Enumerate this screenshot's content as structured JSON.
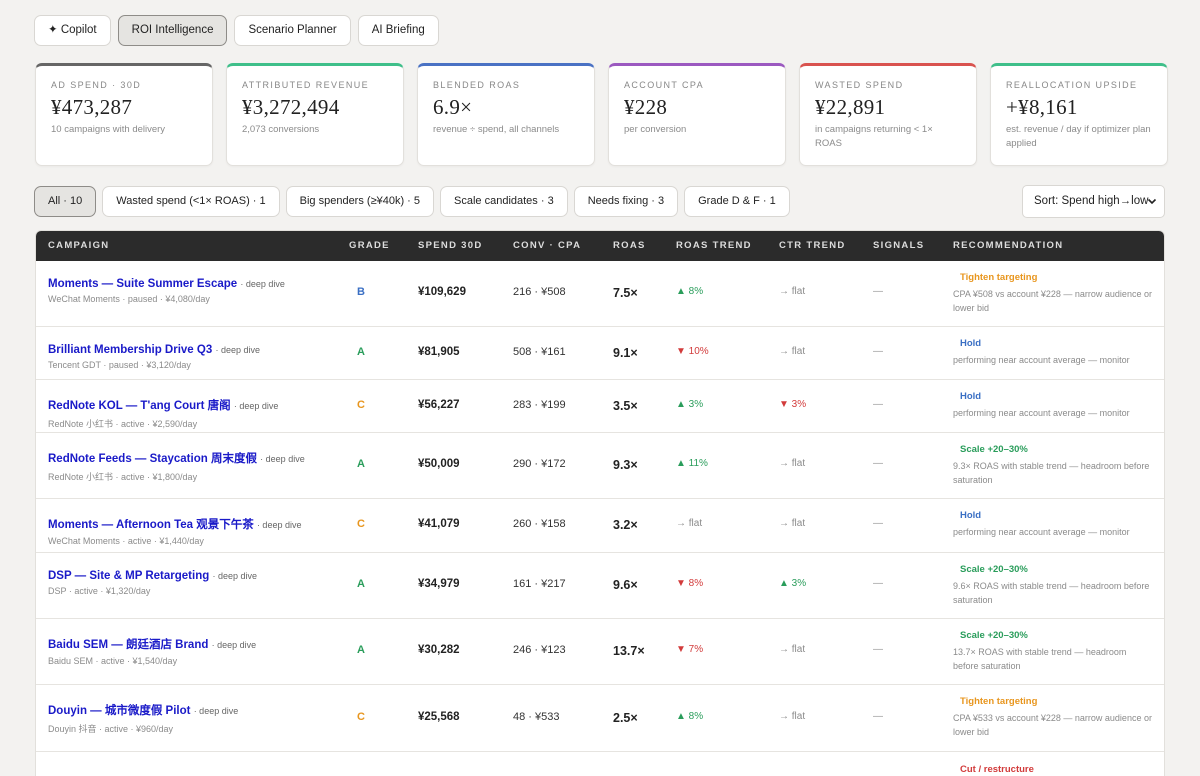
{
  "tabs": [
    {
      "label": "✦ Copilot",
      "active": false
    },
    {
      "label": "ROI Intelligence",
      "active": true
    },
    {
      "label": "Scenario Planner",
      "active": false
    },
    {
      "label": "AI Briefing",
      "active": false
    }
  ],
  "kpis": [
    {
      "label": "Ad spend · 30d",
      "value": "¥473,287",
      "sub": "10 campaigns with delivery",
      "color": "#666666"
    },
    {
      "label": "Attributed revenue",
      "value": "¥3,272,494",
      "sub": "2,073 conversions",
      "color": "#3fbf8a"
    },
    {
      "label": "Blended ROAS",
      "value": "6.9×",
      "sub": "revenue ÷ spend, all channels",
      "color": "#4a72c4"
    },
    {
      "label": "Account CPA",
      "value": "¥228",
      "sub": "per conversion",
      "color": "#9b59c0"
    },
    {
      "label": "Wasted spend",
      "value": "¥22,891",
      "sub": "in campaigns returning < 1× ROAS",
      "color": "#d9534f"
    },
    {
      "label": "Reallocation upside",
      "value": "+¥8,161",
      "sub": "est. revenue / day if optimizer plan applied",
      "color": "#3fbf8a"
    }
  ],
  "filters": [
    {
      "label": "All · 10",
      "active": true
    },
    {
      "label": "Wasted spend (<1× ROAS) · 1",
      "active": false
    },
    {
      "label": "Big spenders (≥¥40k) · 5",
      "active": false
    },
    {
      "label": "Scale candidates · 3",
      "active": false
    },
    {
      "label": "Needs fixing · 3",
      "active": false
    },
    {
      "label": "Grade D & F · 1",
      "active": false
    }
  ],
  "sort": {
    "label": "Sort: Spend high→low"
  },
  "table": {
    "headers": [
      "Campaign",
      "Grade",
      "Spend 30d",
      "Conv · CPA",
      "ROAS",
      "ROAS trend",
      "CTR trend",
      "Signals",
      "Recommendation"
    ],
    "rows": [
      {
        "name": "Moments — Suite Summer Escape",
        "deep": "· deep dive",
        "meta": "WeChat Moments · paused · ¥4,080/day",
        "grade": "B",
        "spend": "¥109,629",
        "conv": "216 · ¥508",
        "roas": "7.5×",
        "rtrend": "▲ 8%",
        "rdir": "up",
        "ctrend": "→ flat",
        "cdir": "flat",
        "signals": "—",
        "rec_title": "Tighten targeting",
        "rec_color": "#e8961e",
        "rec_text": "CPA ¥508 vs account ¥228 — narrow audience or lower bid"
      },
      {
        "name": "Brilliant Membership Drive Q3",
        "deep": "· deep dive",
        "meta": "Tencent GDT · paused · ¥3,120/day",
        "grade": "A",
        "spend": "¥81,905",
        "conv": "508 · ¥161",
        "roas": "9.1×",
        "rtrend": "▼ 10%",
        "rdir": "down",
        "ctrend": "→ flat",
        "cdir": "flat",
        "signals": "—",
        "rec_title": "Hold",
        "rec_color": "#3a6fc4",
        "rec_text": "performing near account average — monitor"
      },
      {
        "name": "RedNote KOL — T'ang Court 唐阁",
        "deep": "· deep dive",
        "meta": "RedNote 小红书 · active · ¥2,590/day",
        "grade": "C",
        "spend": "¥56,227",
        "conv": "283 · ¥199",
        "roas": "3.5×",
        "rtrend": "▲ 3%",
        "rdir": "up",
        "ctrend": "▼ 3%",
        "cdir": "down",
        "signals": "—",
        "rec_title": "Hold",
        "rec_color": "#3a6fc4",
        "rec_text": "performing near account average — monitor"
      },
      {
        "name": "RedNote Feeds — Staycation 周末度假",
        "deep": "· deep dive",
        "meta": "RedNote 小红书 · active · ¥1,800/day",
        "grade": "A",
        "spend": "¥50,009",
        "conv": "290 · ¥172",
        "roas": "9.3×",
        "rtrend": "▲ 11%",
        "rdir": "up",
        "ctrend": "→ flat",
        "cdir": "flat",
        "signals": "—",
        "rec_title": "Scale +20–30%",
        "rec_color": "#2a9d5b",
        "rec_text": "9.3× ROAS with stable trend — headroom before saturation"
      },
      {
        "name": "Moments — Afternoon Tea 观景下午茶",
        "deep": "· deep dive",
        "meta": "WeChat Moments · active · ¥1,440/day",
        "grade": "C",
        "spend": "¥41,079",
        "conv": "260 · ¥158",
        "roas": "3.2×",
        "rtrend": "→ flat",
        "rdir": "flat",
        "ctrend": "→ flat",
        "cdir": "flat",
        "signals": "—",
        "rec_title": "Hold",
        "rec_color": "#3a6fc4",
        "rec_text": "performing near account average — monitor"
      },
      {
        "name": "DSP — Site & MP Retargeting",
        "deep": "· deep dive",
        "meta": "DSP · active · ¥1,320/day",
        "grade": "A",
        "spend": "¥34,979",
        "conv": "161 · ¥217",
        "roas": "9.6×",
        "rtrend": "▼ 8%",
        "rdir": "down",
        "ctrend": "▲ 3%",
        "cdir": "up",
        "signals": "—",
        "rec_title": "Scale +20–30%",
        "rec_color": "#2a9d5b",
        "rec_text": "9.6× ROAS with stable trend — headroom before saturation"
      },
      {
        "name": "Baidu SEM — 朗廷酒店 Brand",
        "deep": "· deep dive",
        "meta": "Baidu SEM · active · ¥1,540/day",
        "grade": "A",
        "spend": "¥30,282",
        "conv": "246 · ¥123",
        "roas": "13.7×",
        "rtrend": "▼ 7%",
        "rdir": "down",
        "ctrend": "→ flat",
        "cdir": "flat",
        "signals": "—",
        "rec_title": "Scale +20–30%",
        "rec_color": "#2a9d5b",
        "rec_text": "13.7× ROAS with stable trend — headroom before saturation"
      },
      {
        "name": "Douyin — 城市微度假 Pilot",
        "deep": "· deep dive",
        "meta": "Douyin 抖音 · active · ¥960/day",
        "grade": "C",
        "spend": "¥25,568",
        "conv": "48 · ¥533",
        "roas": "2.5×",
        "rtrend": "▲ 8%",
        "rdir": "up",
        "ctrend": "→ flat",
        "cdir": "flat",
        "signals": "—",
        "rec_title": "Tighten targeting",
        "rec_color": "#e8961e",
        "rec_text": "CPA ¥533 vs account ¥228 — narrow audience or lower bid"
      },
      {
        "name": "",
        "deep": "",
        "meta": "",
        "grade": "",
        "spend": "",
        "conv": "",
        "roas": "",
        "rtrend": "",
        "rdir": "flat",
        "ctrend": "",
        "cdir": "flat",
        "signals": "",
        "rec_title": "Cut / restructure",
        "rec_color": "#d23b3b",
        "rec_text": ""
      }
    ]
  },
  "colors": {
    "grade_A": "#2a9d5b",
    "grade_B": "#3a6fc4",
    "grade_C": "#e8961e"
  }
}
